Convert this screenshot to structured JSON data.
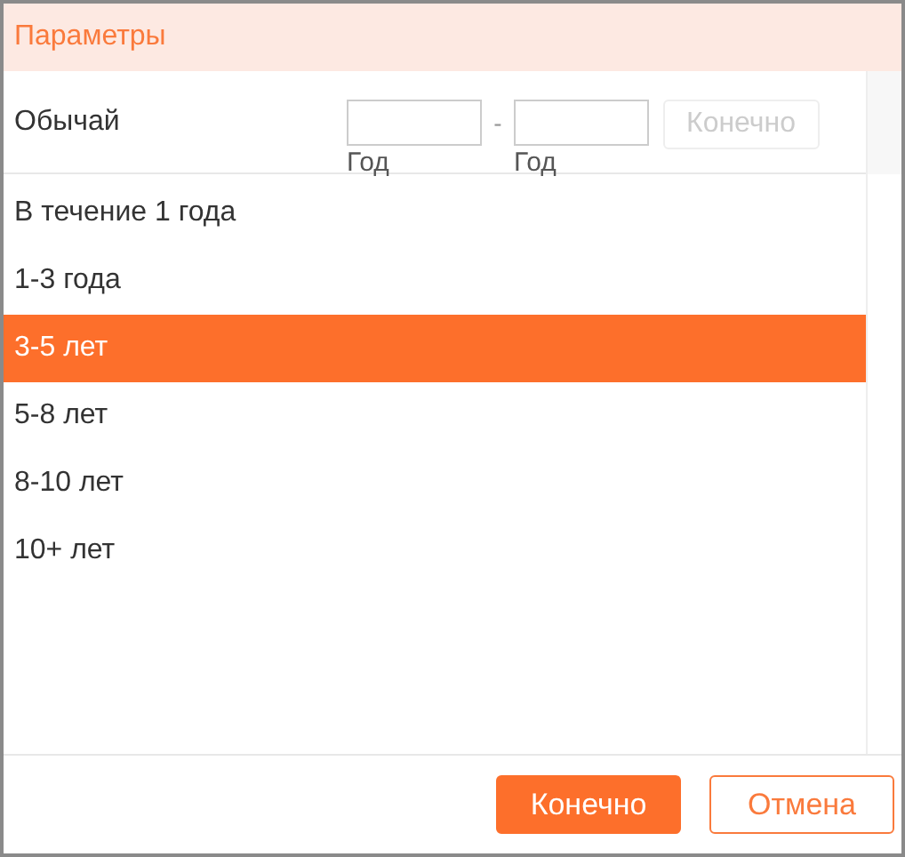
{
  "window": {
    "title": "Параметры"
  },
  "custom": {
    "label": "Обычай",
    "from_caption": "Год",
    "separator": "-",
    "to_caption": "Год",
    "apply": {
      "label": "Конечно",
      "disabled": true
    }
  },
  "options": [
    {
      "label": "В течение 1 года",
      "selected": false
    },
    {
      "label": "1-3 года",
      "selected": false
    },
    {
      "label": "3-5 лет",
      "selected": true
    },
    {
      "label": "5-8 лет",
      "selected": false
    },
    {
      "label": "8-10 лет",
      "selected": false
    },
    {
      "label": "10+ лет",
      "selected": false
    }
  ],
  "buttons": [
    {
      "label": "Конечно",
      "kind": "primary"
    },
    {
      "label": "Отмена",
      "kind": "secondary"
    }
  ]
}
